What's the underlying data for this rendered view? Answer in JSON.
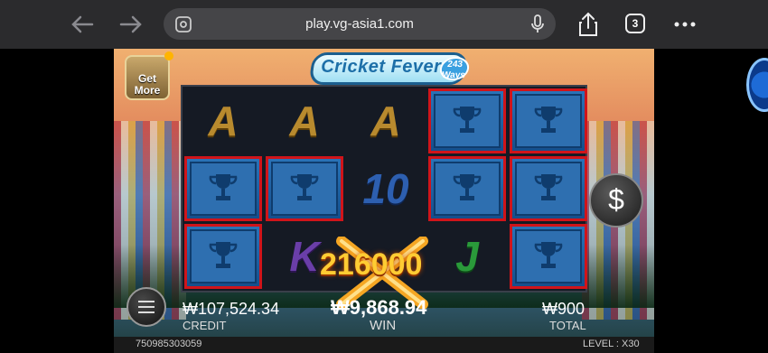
{
  "browser": {
    "url": "play.vg-asia1.com",
    "tab_count": "3"
  },
  "game": {
    "title": "Cricket Fever",
    "title_badge": "243 Ways",
    "get_more_label": "Get More",
    "win_overlay_amount": "216000",
    "grid": [
      [
        "A",
        "A",
        "A",
        "trophy",
        "trophy"
      ],
      [
        "trophy",
        "trophy",
        "10",
        "trophy",
        "trophy"
      ],
      [
        "trophy",
        "K",
        "wild",
        "J",
        "trophy"
      ]
    ],
    "credit_value": "₩107,524.34",
    "credit_label": "CREDIT",
    "win_value": "₩9,868.94",
    "win_label": "WIN",
    "total_value": "₩900",
    "total_label": "TOTAL",
    "spin_button_symbol": "$",
    "game_id": "750985303059",
    "level_text": "LEVEL : X30"
  }
}
